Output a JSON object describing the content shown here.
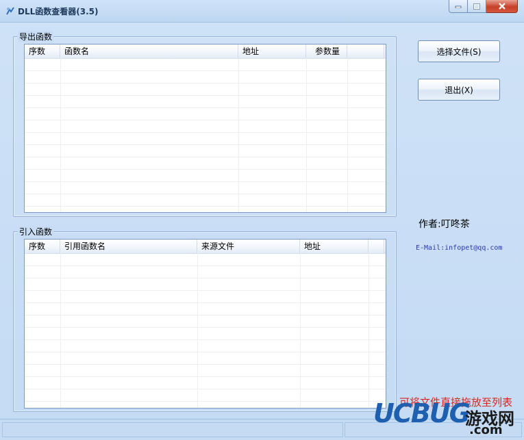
{
  "window": {
    "title": "DLL函数查看器(3.5)",
    "icons": {
      "app": "dll-app-icon",
      "minimize": "minimize-icon",
      "maximize": "maximize-icon",
      "close": "close-icon"
    }
  },
  "export_group": {
    "label": "导出函数",
    "columns": [
      "序数",
      "函数名",
      "地址",
      "参数量"
    ]
  },
  "import_group": {
    "label": "引入函数",
    "columns": [
      "序数",
      "引用函数名",
      "来源文件",
      "地址"
    ]
  },
  "buttons": {
    "select_file": "选择文件(S)",
    "exit": "退出(X)"
  },
  "author": "作者:叮咚茶",
  "email": "E-Mail:infopet@qq.com",
  "hint": "可将文件直接拖放至列表",
  "watermark": {
    "logo": "UCBUG",
    "game": "游戏网",
    "domain": ".com"
  },
  "colors": {
    "hint": "#d8261d",
    "email": "#2b3aa8",
    "logo": "#1f5fb0"
  }
}
